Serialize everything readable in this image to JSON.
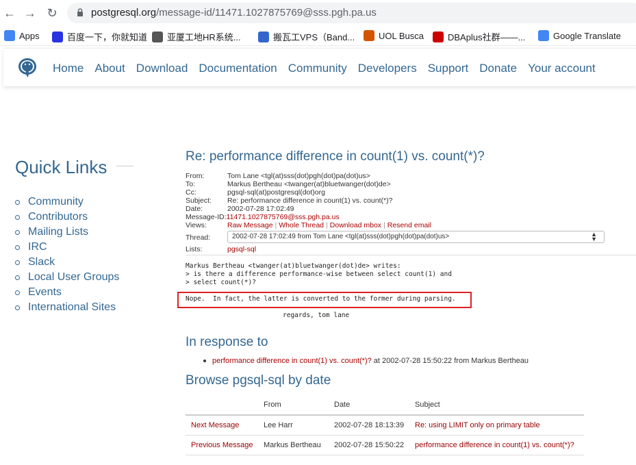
{
  "browser": {
    "url_host": "postgresql.org",
    "url_path": "/message-id/11471.1027875769@sss.pgh.pa.us",
    "bookmarks": [
      {
        "label": "Apps",
        "icon": "apps-grid-icon",
        "color": "#4285f4"
      },
      {
        "label": "百度一下，你就知道",
        "icon": "baidu-paw-icon",
        "color": "#2932e1"
      },
      {
        "label": "亚厦工地HR系统...",
        "icon": "chart-icon",
        "color": "#555555"
      },
      {
        "label": "搬瓦工VPS（Band...",
        "icon": "bandwagon-icon",
        "color": "#3366cc"
      },
      {
        "label": "UOL Busca",
        "icon": "uol-icon",
        "color": "#d35400"
      },
      {
        "label": "DBAplus社群——...",
        "icon": "huawei-icon",
        "color": "#cc0000"
      },
      {
        "label": "Google Translate",
        "icon": "translate-icon",
        "color": "#4285f4"
      }
    ]
  },
  "site_nav": {
    "items": [
      "Home",
      "About",
      "Download",
      "Documentation",
      "Community",
      "Developers",
      "Support",
      "Donate",
      "Your account"
    ]
  },
  "quick_links": {
    "title": "Quick Links",
    "items": [
      "Community",
      "Contributors",
      "Mailing Lists",
      "IRC",
      "Slack",
      "Local User Groups",
      "Events",
      "International Sites"
    ]
  },
  "message": {
    "title": "Re: performance difference in count(1) vs. count(*)?",
    "headers": [
      {
        "label": "From:",
        "value": "Tom Lane <tgl(at)sss(dot)pgh(dot)pa(dot)us>"
      },
      {
        "label": "To:",
        "value": "Markus Bertheau <twanger(at)bluetwanger(dot)de>"
      },
      {
        "label": "Cc:",
        "value": "pgsql-sql(at)postgresql(dot)org"
      },
      {
        "label": "Subject:",
        "value": "Re: performance difference in count(1) vs. count(*)?"
      },
      {
        "label": "Date:",
        "value": "2002-07-28 17:02:49"
      }
    ],
    "message_id_label": "Message-ID:",
    "message_id": "11471.1027875769@sss.pgh.pa.us",
    "views_label": "Views:",
    "views": [
      "Raw Message",
      "Whole Thread",
      "Download mbox",
      "Resend email"
    ],
    "thread_label": "Thread:",
    "thread_selected": "2002-07-28 17:02:49 from Tom Lane <tgl(at)sss(dot)pgh(dot)pa(dot)us>",
    "lists_label": "Lists:",
    "list_name": "pgsql-sql",
    "body_quote": "Markus Bertheau <twanger(at)bluetwanger(dot)de> writes:\n> is there a difference performance-wise between select count(1) and\n> select count(*)?",
    "body_highlight": "Nope.  In fact, the latter is converted to the former during parsing.",
    "body_sign": "regards, tom lane"
  },
  "in_response": {
    "heading": "In response to",
    "link": "performance difference in count(1) vs. count(*)?",
    "suffix": " at 2002-07-28 15:50:22 from Markus Bertheau"
  },
  "browse": {
    "heading": "Browse pgsql-sql by date",
    "columns": [
      "",
      "From",
      "Date",
      "Subject"
    ],
    "rows": [
      {
        "kind": "Next Message",
        "from": "Lee Harr",
        "date": "2002-07-28 18:13:39",
        "subject": "Re: using LIMIT only on primary table"
      },
      {
        "kind": "Previous Message",
        "from": "Markus Bertheau",
        "date": "2002-07-28 15:50:22",
        "subject": "performance difference in count(1) vs. count(*)?"
      }
    ]
  }
}
